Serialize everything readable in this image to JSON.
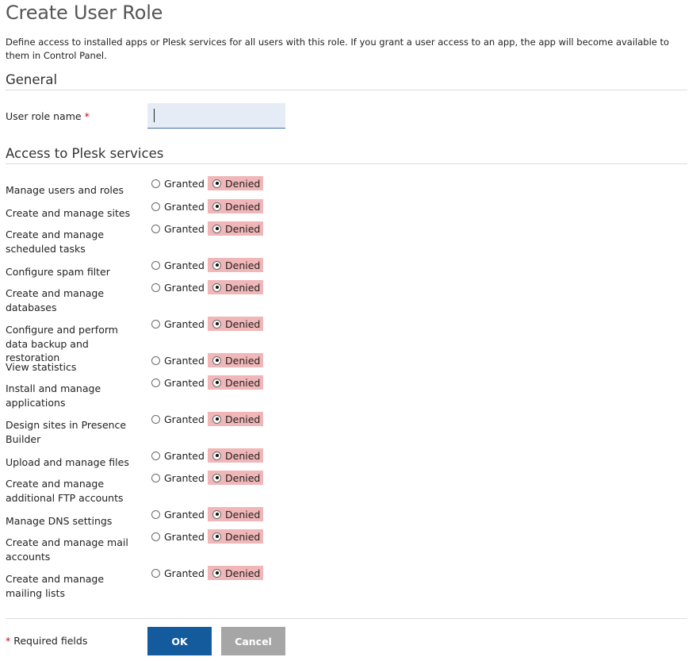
{
  "page": {
    "title": "Create User Role",
    "description": "Define access to installed apps or Plesk services for all users with this role. If you grant a user access to an app, the app will become available to them in Control Panel."
  },
  "general": {
    "heading": "General",
    "role_name_label": "User role name",
    "required_mark": "*",
    "role_name_value": ""
  },
  "access": {
    "heading": "Access to Plesk services",
    "granted_label": "Granted",
    "denied_label": "Denied",
    "denied_color": "#f0b6b8",
    "services": [
      {
        "label": "Manage users and roles",
        "value": "Denied"
      },
      {
        "label": "Create and manage sites",
        "value": "Denied"
      },
      {
        "label": "Create and manage scheduled tasks",
        "value": "Denied"
      },
      {
        "label": "Configure spam filter",
        "value": "Denied"
      },
      {
        "label": "Create and manage databases",
        "value": "Denied"
      },
      {
        "label": "Configure and perform data backup and restoration",
        "value": "Denied"
      },
      {
        "label": "View statistics",
        "value": "Denied"
      },
      {
        "label": "Install and manage applications",
        "value": "Denied"
      },
      {
        "label": "Design sites in Presence Builder",
        "value": "Denied"
      },
      {
        "label": "Upload and manage files",
        "value": "Denied"
      },
      {
        "label": "Create and manage additional FTP accounts",
        "value": "Denied"
      },
      {
        "label": "Manage DNS settings",
        "value": "Denied"
      },
      {
        "label": "Create and manage mail accounts",
        "value": "Denied"
      },
      {
        "label": "Create and manage mailing lists",
        "value": "Denied"
      }
    ]
  },
  "footer": {
    "required_mark": "*",
    "required_text": "Required fields",
    "ok_label": "OK",
    "cancel_label": "Cancel",
    "ok_color": "#145b9e",
    "cancel_color": "#a6a6a6"
  }
}
